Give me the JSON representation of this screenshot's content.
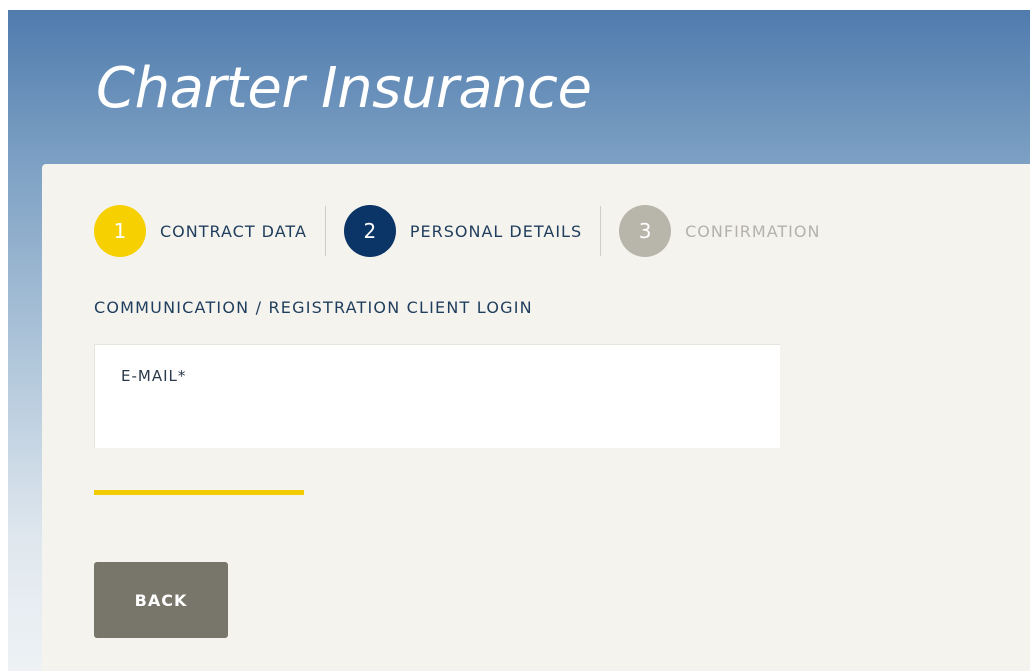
{
  "brand": {
    "title": "Charter Insurance"
  },
  "steps": [
    {
      "number": "1",
      "label": "CONTRACT DATA",
      "circle_color": "#f6d000",
      "label_color": "#1f3d5c"
    },
    {
      "number": "2",
      "label": "PERSONAL DETAILS",
      "circle_color": "#0b3566",
      "label_color": "#1f3d5c"
    },
    {
      "number": "3",
      "label": "CONFIRMATION",
      "circle_color": "#b8b5ab",
      "label_color": "#b4b2aa"
    }
  ],
  "section": {
    "label": "COMMUNICATION / REGISTRATION CLIENT LOGIN"
  },
  "email_field": {
    "label": "E-MAIL*",
    "value": "",
    "placeholder": ""
  },
  "buttons": {
    "back_label": "BACK"
  },
  "colors": {
    "accent": "#f2cc00",
    "primary": "#0b3566",
    "inactive": "#b8b5ab",
    "button": "#78766a"
  }
}
